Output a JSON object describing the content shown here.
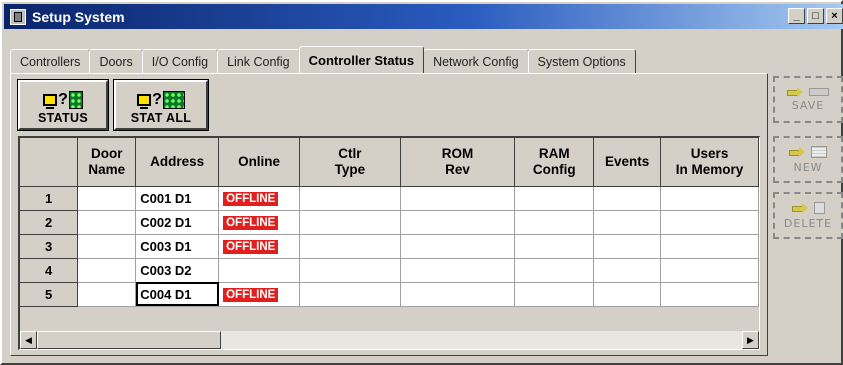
{
  "window": {
    "title": "Setup System",
    "controls": {
      "minimize": "_",
      "maximize": "□",
      "close": "×"
    }
  },
  "tabs": [
    {
      "label": "Controllers",
      "active": false
    },
    {
      "label": "Doors",
      "active": false
    },
    {
      "label": "I/O Config",
      "active": false
    },
    {
      "label": "Link Config",
      "active": false
    },
    {
      "label": "Controller Status",
      "active": true
    },
    {
      "label": "Network Config",
      "active": false
    },
    {
      "label": "System Options",
      "active": false
    }
  ],
  "toolbar": {
    "status_label": "STATUS",
    "stat_all_label": "STAT ALL",
    "question_glyph": "?"
  },
  "grid": {
    "headers": [
      {
        "line1": "",
        "line2": ""
      },
      {
        "line1": "Door",
        "line2": "Name"
      },
      {
        "line1": "Address",
        "line2": ""
      },
      {
        "line1": "Online",
        "line2": ""
      },
      {
        "line1": "Ctlr",
        "line2": "Type"
      },
      {
        "line1": "ROM",
        "line2": "Rev"
      },
      {
        "line1": "RAM",
        "line2": "Config"
      },
      {
        "line1": "Events",
        "line2": ""
      },
      {
        "line1": "Users",
        "line2": "In Memory"
      }
    ],
    "rows": [
      {
        "num": "1",
        "door_name": "",
        "address": "C001 D1",
        "online": "OFFLINE",
        "selected": false
      },
      {
        "num": "2",
        "door_name": "",
        "address": "C002 D1",
        "online": "OFFLINE",
        "selected": false
      },
      {
        "num": "3",
        "door_name": "",
        "address": "C003 D1",
        "online": "OFFLINE",
        "selected": false
      },
      {
        "num": "4",
        "door_name": "",
        "address": "C003 D2",
        "online": "",
        "selected": false
      },
      {
        "num": "5",
        "door_name": "",
        "address": "C004 D1",
        "online": "OFFLINE",
        "selected": true
      }
    ],
    "scroll": {
      "left_arrow": "◀",
      "right_arrow": "▶"
    }
  },
  "actions": {
    "save_label": "SAVE",
    "new_label": "NEW",
    "delete_label": "DELETE"
  },
  "colors": {
    "title_bar": "#0a246a",
    "offline_badge": "#e0201e",
    "window_face": "#d4d0c8"
  }
}
